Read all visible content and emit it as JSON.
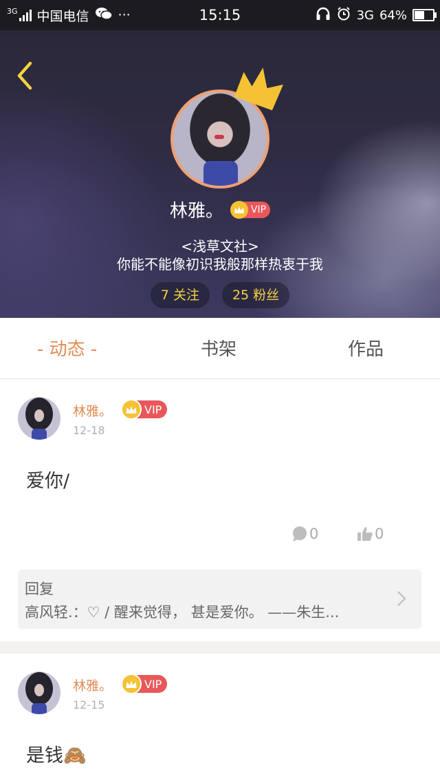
{
  "status_bar": {
    "network_small": "3G",
    "carrier": "中国电信",
    "more": "···",
    "time": "15:15",
    "network": "3G",
    "battery": "64%",
    "battery_level": 0.64
  },
  "profile": {
    "name": "林雅。",
    "vip_label": "VIP",
    "bio_line1": "<浅草文社>",
    "bio_line2": "你能不能像初识我般那样热衷于我",
    "following": "7 关注",
    "followers": "25 粉丝"
  },
  "tabs": [
    {
      "label": "- 动态 -",
      "active": true
    },
    {
      "label": "书架",
      "active": false
    },
    {
      "label": "作品",
      "active": false
    }
  ],
  "posts": [
    {
      "author": "林雅。",
      "vip_label": "VIP",
      "date": "12-18",
      "content": "爱你/",
      "comments": "0",
      "likes": "0",
      "reply_title": "回复",
      "reply_text": "高风轻.：♡ / 醒来觉得， 甚是爱你。 ——朱生..."
    },
    {
      "author": "林雅。",
      "vip_label": "VIP",
      "date": "12-15",
      "content": "是钱🙈"
    }
  ],
  "colors": {
    "accent": "#e38b56",
    "vip_red": "#e8585a",
    "gold": "#f6c235",
    "stat_text": "#f5d245"
  }
}
